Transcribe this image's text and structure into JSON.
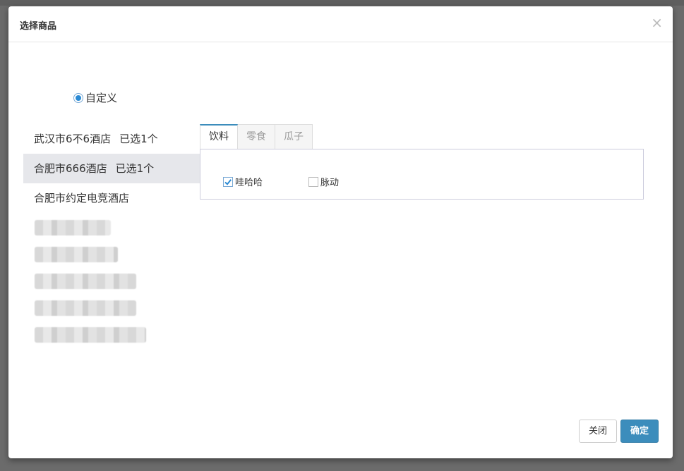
{
  "modal": {
    "title": "选择商品",
    "close_glyph": "×"
  },
  "mode": {
    "label": "自定义",
    "selected": true
  },
  "stores": [
    {
      "name": "武汉市6不6酒店",
      "selected_text": "已选1个",
      "active": false
    },
    {
      "name": "合肥市666酒店",
      "selected_text": "已选1个",
      "active": true
    },
    {
      "name": "合肥市约定电竞酒店",
      "selected_text": "",
      "active": false
    }
  ],
  "tabs": [
    {
      "label": "饮料",
      "active": true
    },
    {
      "label": "零食",
      "active": false
    },
    {
      "label": "瓜子",
      "active": false
    }
  ],
  "products": [
    {
      "label": "哇哈哈",
      "checked": true
    },
    {
      "label": "脉动",
      "checked": false
    }
  ],
  "footer": {
    "close_label": "关闭",
    "ok_label": "确定"
  },
  "colors": {
    "accent": "#3c8dbc",
    "active_row": "#e6e7eb"
  }
}
